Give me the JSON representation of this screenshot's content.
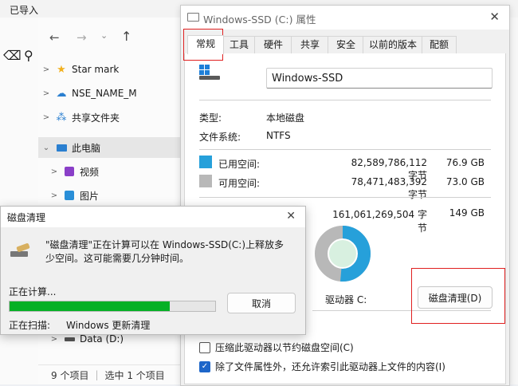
{
  "background": {
    "top_left_text": "已导入",
    "nav_items": [
      {
        "label": "Star mark"
      },
      {
        "label": "NSE_NAME_M"
      },
      {
        "label": "共享文件夹"
      },
      {
        "label": "此电脑"
      },
      {
        "label": "视频"
      },
      {
        "label": "图片"
      },
      {
        "label": "Data (D:)"
      }
    ],
    "status_count": "9 个项目",
    "status_selected": "选中 1 个项目"
  },
  "properties": {
    "title": "Windows-SSD (C:) 属性",
    "tabs": [
      "常规",
      "工具",
      "硬件",
      "共享",
      "安全",
      "以前的版本",
      "配额"
    ],
    "drive_name": "Windows-SSD",
    "type_label": "类型:",
    "type_value": "本地磁盘",
    "fs_label": "文件系统:",
    "fs_value": "NTFS",
    "used_label": "已用空间:",
    "used_bytes": "82,589,786,112 字节",
    "used_gb": "76.9 GB",
    "free_label": "可用空间:",
    "free_bytes": "78,471,483,392 字节",
    "free_gb": "73.0 GB",
    "capacity_bytes": "161,061,269,504 字节",
    "capacity_gb": "149 GB",
    "drive_label": "驱动器 C:",
    "cleanup_button": "磁盘清理(D)",
    "compress_label": "压缩此驱动器以节约磁盘空间(C)",
    "index_label": "除了文件属性外，还允许索引此驱动器上文件的内容(I)",
    "used_fraction": 0.513,
    "colors": {
      "used": "#26a0da",
      "free": "#b8b8b8"
    }
  },
  "cleanup": {
    "title": "磁盘清理",
    "message": "\"磁盘清理\"正在计算可以在 Windows-SSD(C:)上释放多少空间。这可能需要几分钟时间。",
    "calculating": "正在计算...",
    "cancel_button": "取消",
    "scanning_label": "正在扫描:",
    "scanning_value": "Windows 更新清理",
    "progress": 0.78
  }
}
